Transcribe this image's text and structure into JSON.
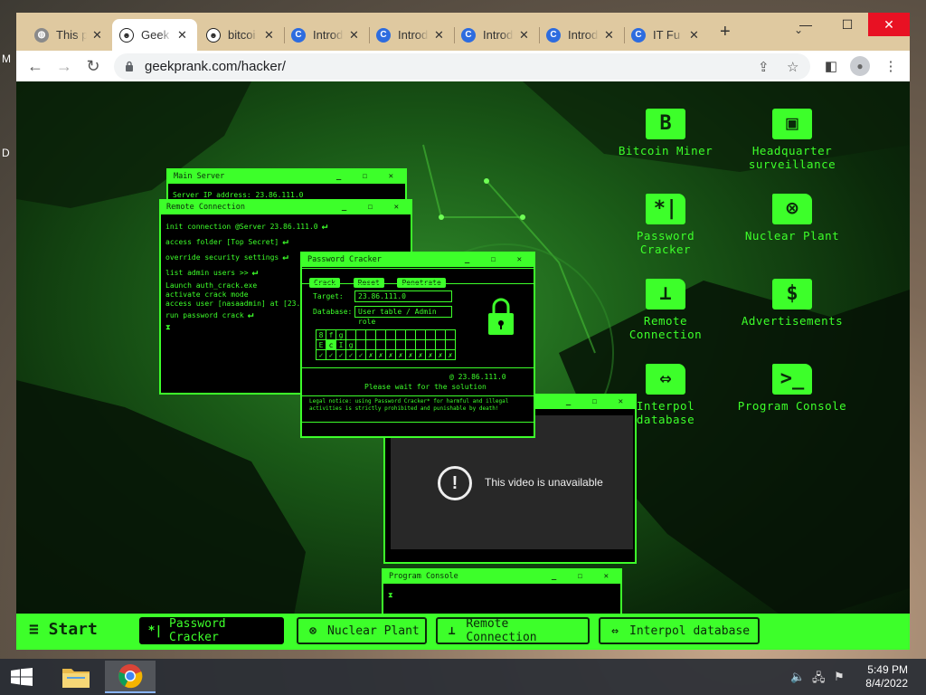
{
  "desktop_edge_letters": [
    "M",
    "D"
  ],
  "browser": {
    "tabs": [
      {
        "title": "This p",
        "icon": "globe-icon",
        "active": false
      },
      {
        "title": "Geek",
        "icon": "troll-face-icon",
        "active": true
      },
      {
        "title": "bitcoi",
        "icon": "troll-face-icon",
        "active": false
      },
      {
        "title": "Introd",
        "icon": "c-logo-icon",
        "active": false
      },
      {
        "title": "Introd",
        "icon": "c-logo-icon",
        "active": false
      },
      {
        "title": "Introd",
        "icon": "c-logo-icon",
        "active": false
      },
      {
        "title": "Introd",
        "icon": "c-logo-icon",
        "active": false
      },
      {
        "title": "IT Fu",
        "icon": "c-logo-icon",
        "active": false
      }
    ],
    "tab_close_glyph": "✕",
    "new_tab": "+",
    "url": "geekprank.com/hacker/",
    "window_controls": {
      "minimize": "—",
      "maximize": "☐",
      "close": "✕"
    }
  },
  "desktop_icons": [
    {
      "id": "bitcoin-miner",
      "glyph": "B",
      "label": "Bitcoin Miner"
    },
    {
      "id": "headquarter-surveillance",
      "glyph": "▣",
      "label": "Headquarter\nsurveillance"
    },
    {
      "id": "password-cracker",
      "glyph": "*|",
      "label": "Password\nCracker"
    },
    {
      "id": "nuclear-plant",
      "glyph": "⊗",
      "label": "Nuclear Plant"
    },
    {
      "id": "remote-connection",
      "glyph": "⊥",
      "label": "Remote\nConnection"
    },
    {
      "id": "advertisements",
      "glyph": "$",
      "label": "Advertisements"
    },
    {
      "id": "interpol-database",
      "glyph": "⇔",
      "label": "Interpol\ndatabase"
    },
    {
      "id": "program-console",
      "glyph": ">_",
      "label": "Program Console"
    }
  ],
  "windows": {
    "main_server": {
      "title": "Main Server",
      "lines": [
        "Server IP address: 23.86.111.0"
      ]
    },
    "remote_connection": {
      "title": "Remote Connection",
      "lines": [
        {
          "text": "init connection @Server 23.86.111.0",
          "ret": true
        },
        {
          "text": "access folder [Top Secret]",
          "ret": true
        },
        {
          "text": "override security settings",
          "ret": true
        },
        {
          "text": "list admin users >>",
          "ret": true
        },
        {
          "text": "Launch auth_crack.exe",
          "ret": false
        },
        {
          "text": "activate crack mode",
          "ret": false
        },
        {
          "text": "access user [nasaadmin] at [23.86",
          "ret": false
        },
        {
          "text": "run password crack",
          "ret": true
        },
        {
          "text": "⧗",
          "ret": false
        }
      ]
    },
    "password_cracker": {
      "title": "Password Cracker",
      "buttons": [
        "Crack",
        "Reset",
        "Penetrate"
      ],
      "target_label": "Target:",
      "target_value": "23.86.111.0",
      "database_label": "Database:",
      "database_value": "User table / Admin role",
      "grid_rows": [
        [
          "8",
          "f",
          "g",
          "",
          "",
          "",
          "",
          "",
          "",
          "",
          "",
          "",
          "",
          ""
        ],
        [
          "E",
          "c",
          "I",
          "g",
          "",
          "",
          "",
          "",
          "",
          "",
          "",
          "",
          "",
          ""
        ],
        [
          "✓",
          "✓",
          "✓",
          "✓",
          "✓",
          "✗",
          "✗",
          "✗",
          "✗",
          "✗",
          "✗",
          "✗",
          "✗",
          "✗"
        ]
      ],
      "ip_line": "@ 23.86.111.0",
      "status": "Please wait for the solution",
      "legal": "Legal notice: using Password Cracker* for harmful and illegal activities is strictly prohibited and punishable by death!"
    },
    "video": {
      "message": "This video is unavailable"
    },
    "program_console": {
      "title": "Program Console",
      "lines": [
        "⧗"
      ]
    }
  },
  "hacker_taskbar": {
    "start": "≡ Start",
    "items": [
      {
        "icon": "*|",
        "label": "Password Cracker",
        "active": true
      },
      {
        "icon": "⊗",
        "label": "Nuclear Plant",
        "active": false
      },
      {
        "icon": "⊥",
        "label": "Remote Connection",
        "active": false
      },
      {
        "icon": "⇔",
        "label": "Interpol database",
        "active": false
      }
    ]
  },
  "win_ctl_glyphs": "_ ☐ ✕",
  "windows_taskbar": {
    "time": "5:49 PM",
    "date": "8/4/2022"
  },
  "colors": {
    "hacker_green": "#3dff2a",
    "close_red": "#e81123"
  }
}
